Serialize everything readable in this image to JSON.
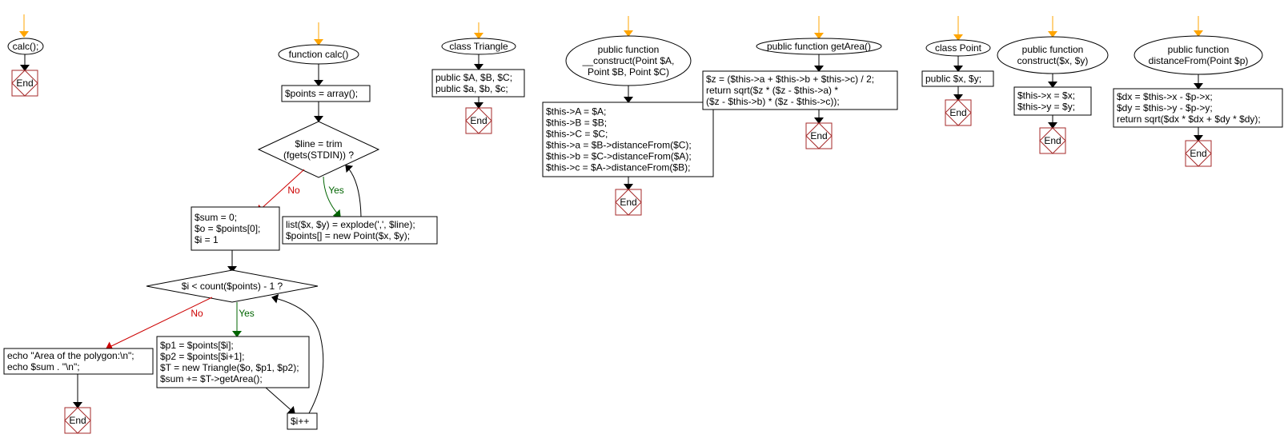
{
  "colors": {
    "entry_arrow": "#ffa500",
    "no_edge": "#cc0000",
    "yes_edge": "#006400",
    "end_border": "#a52a2a",
    "edge": "#000000"
  },
  "flows": [
    {
      "start": [
        "calc();"
      ],
      "end": "End"
    },
    {
      "start": [
        "function calc()"
      ],
      "init": [
        "$points = array();"
      ],
      "cond1": [
        "$line = trim",
        "(fgets(STDIN)) ?"
      ],
      "cond1_no": "No",
      "cond1_yes": "Yes",
      "loop1_body": [
        "list($x, $y) = explode(',', $line);",
        "$points[] = new Point($x, $y);"
      ],
      "init2": [
        "$sum = 0;",
        "$o = $points[0];",
        "$i = 1"
      ],
      "cond2": [
        "$i < count($points) - 1 ?"
      ],
      "cond2_no": "No",
      "cond2_yes": "Yes",
      "loop2_body": [
        "$p1 = $points[$i];",
        "$p2 = $points[$i+1];",
        "$T = new Triangle($o, $p1, $p2);",
        "$sum += $T->getArea();"
      ],
      "increment": [
        "$i++"
      ],
      "output": [
        "echo \"Area of the polygon:\\n\";",
        "echo $sum . \"\\n\";"
      ],
      "end": "End"
    },
    {
      "start": [
        "class Triangle"
      ],
      "body": [
        "public $A, $B, $C;",
        "public $a, $b, $c;"
      ],
      "end": "End"
    },
    {
      "start": [
        "public function",
        "__construct(Point $A,",
        "Point $B, Point $C)"
      ],
      "body": [
        "$this->A = $A;",
        "$this->B = $B;",
        "$this->C = $C;",
        "$this->a = $B->distanceFrom($C);",
        "$this->b = $C->distanceFrom($A);",
        "$this->c = $A->distanceFrom($B);"
      ],
      "end": "End"
    },
    {
      "start": [
        "public function getArea()"
      ],
      "body": [
        "$z = ($this->a + $this->b + $this->c) / 2;",
        "return sqrt($z * ($z - $this->a) *",
        "($z - $this->b) * ($z - $this->c));"
      ],
      "end": "End"
    },
    {
      "start": [
        "class Point"
      ],
      "body": [
        "public $x, $y;"
      ],
      "end": "End"
    },
    {
      "start": [
        "public function",
        "construct($x, $y)"
      ],
      "body": [
        "$this->x = $x;",
        "$this->y = $y;"
      ],
      "end": "End"
    },
    {
      "start": [
        "public function",
        "distanceFrom(Point $p)"
      ],
      "body": [
        "$dx = $this->x - $p->x;",
        "$dy = $this->y - $p->y;",
        "return sqrt($dx * $dx + $dy * $dy);"
      ],
      "end": "End"
    }
  ]
}
